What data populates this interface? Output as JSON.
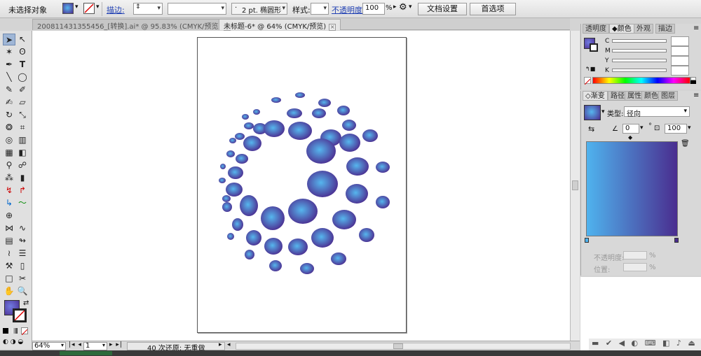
{
  "control_bar": {
    "selection_label": "未选择对象",
    "stroke_label": "描边:",
    "stroke_profile": "2 pt. 椭圆形",
    "style_label": "样式:",
    "opacity_label": "不透明度:",
    "opacity_value": "100",
    "opacity_unit": "%",
    "doc_setup_button": "文档设置",
    "preferences_button": "首选项"
  },
  "tabs": [
    {
      "label": "200811431355456_[转换].ai* @ 95.83% (CMYK/预览)"
    },
    {
      "label": "未标题-6* @ 64% (CMYK/预览)"
    }
  ],
  "color_panel": {
    "tabs": [
      "透明度",
      "颜色",
      "外观",
      "描边"
    ],
    "channels": [
      "C",
      "M",
      "Y",
      "K"
    ]
  },
  "gradient_panel": {
    "tabs": [
      "渐变",
      "路径",
      "属性",
      "颜色",
      "图层"
    ],
    "type_label": "类型:",
    "type_value": "径向",
    "angle_value": "0",
    "angle_unit": "°",
    "ratio_value": "100",
    "opacity_label": "不透明度:",
    "position_label": "位置:",
    "percent": "%",
    "stop_start_color": "#4fb3ee",
    "stop_end_color": "#4a2d8f"
  },
  "status_bar": {
    "zoom": "64%",
    "page": "1",
    "message": "40 次还原; 无重做"
  },
  "colors": {
    "dot_center": "#56b6ee",
    "dot_edge": "#4b2a8e",
    "selection_accent": "#1f3fb3"
  }
}
